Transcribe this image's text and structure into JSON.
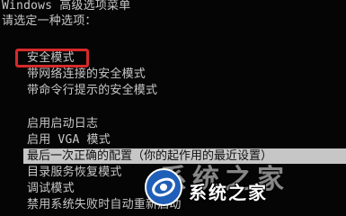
{
  "header": {
    "title": "Windows 高级选项菜单",
    "prompt": "请选定一种选项："
  },
  "options": [
    {
      "label": "安全模式"
    },
    {
      "label": "带网络连接的安全模式"
    },
    {
      "label": "带命令行提示的安全模式"
    },
    {
      "label": "启用启动日志"
    },
    {
      "label": "启用 VGA 模式"
    },
    {
      "label": "最后一次正确的配置（你的起作用的最近设置）"
    },
    {
      "label": "目录服务恢复模式"
    },
    {
      "label": "调试模式"
    },
    {
      "label": "禁用系统失败时自动重新启动"
    }
  ],
  "selected_index": 5,
  "highlighted_index": 0,
  "colors": {
    "background": "#050505",
    "text": "#c8c8c8",
    "selection_bg": "#c6c6c6",
    "highlight_border": "#d62a2a"
  },
  "watermark": {
    "text": "系统之家",
    "ghost_text": "系统之家"
  }
}
